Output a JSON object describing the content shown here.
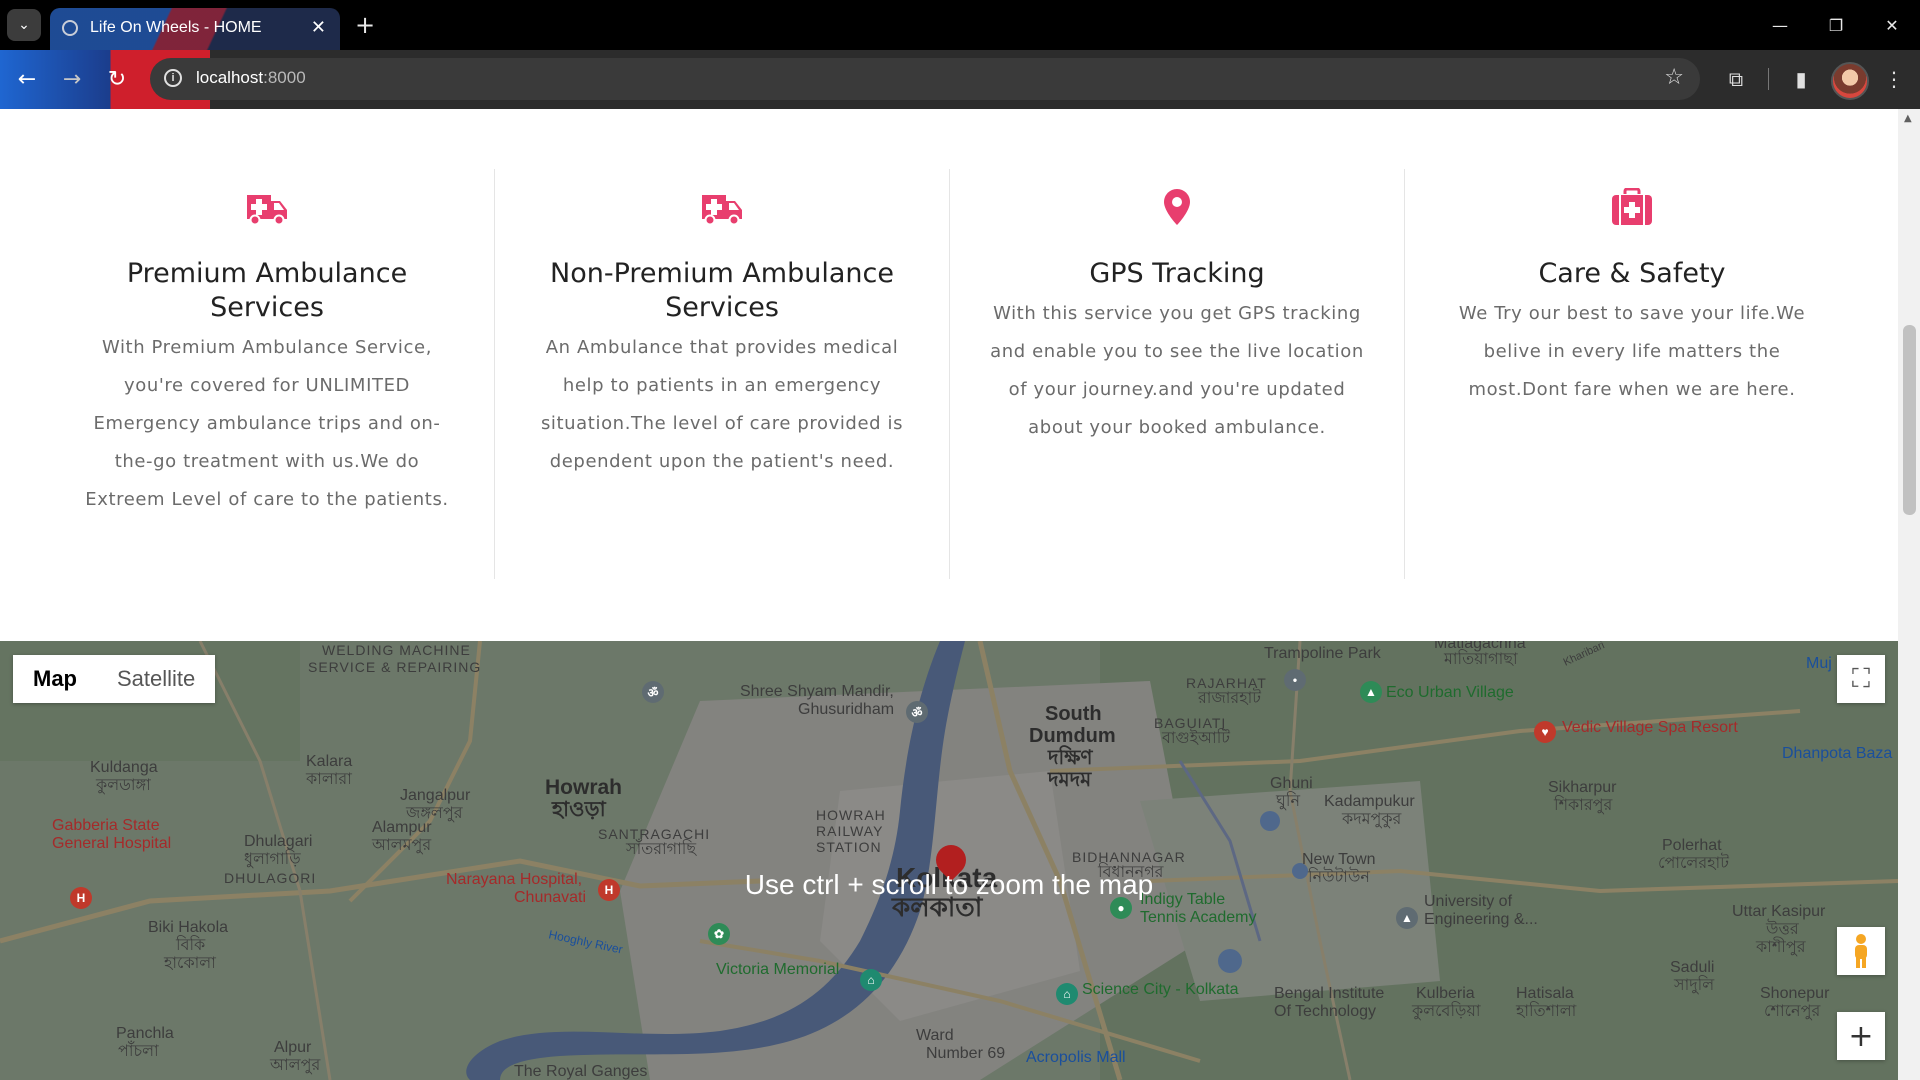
{
  "browser": {
    "tab_title": "Life On Wheels - HOME",
    "tab_close": "✕",
    "new_tab": "+",
    "url_host": "localhost",
    "url_port": ":8000",
    "info_glyph": "i",
    "icons": [
      "tab-search-icon",
      "back-arrow-icon",
      "forward-arrow-icon",
      "reload-icon",
      "site-info-icon",
      "bookmark-star-icon",
      "extensions-icon",
      "side-panel-icon",
      "profile-avatar",
      "kebab-menu-icon",
      "minimize-icon",
      "restore-icon",
      "close-window-icon"
    ]
  },
  "theme": {
    "accent": "#e83e6e",
    "title_color": "#222222",
    "body_text": "#6b6b6b"
  },
  "features": [
    {
      "icon": "ambulance-icon",
      "title": "Premium Ambulance Services",
      "text": "With Premium Ambulance Service, you're covered for UNLIMITED Emergency ambulance trips and on-the-go treatment with us.We do Extreem Level of care to the patients."
    },
    {
      "icon": "ambulance-icon",
      "title": "Non-Premium Ambulance Services",
      "text": "An Ambulance that provides medical help to patients in an emergency situation.The level of care provided is dependent upon the patient's need."
    },
    {
      "icon": "map-pin-icon",
      "title": "GPS Tracking",
      "text": "With this service you get GPS tracking and enable you to see the live location of your journey.and you're updated about your booked ambulance."
    },
    {
      "icon": "medical-kit-icon",
      "title": "Care & Safety",
      "text": "We Try our best to save your life.We belive in every life matters the most.Dont fare when we are here."
    }
  ],
  "map": {
    "type_map": "Map",
    "type_satellite": "Satellite",
    "hint": "Use ctrl + scroll to zoom the map",
    "zoom_in": "+",
    "labels": {
      "welding": "WELDING MACHINE",
      "welding2": "SERVICE & REPAIRING",
      "kuldanga": "Kuldanga",
      "kuldanga_bn": "কুলডাঙ্গা",
      "kalara": "Kalara",
      "kalara_bn": "কালারা",
      "jangalpur": "Jangalpur",
      "jangalpur_bn": "জঙ্গলপুর",
      "howrah": "Howrah",
      "howrah_bn": "হাওড়া",
      "santragachi": "SANTRAGACHI",
      "santragachi_bn": "সাঁতরাগাছি",
      "gabberia": "Gabberia State",
      "gabberia2": "General Hospital",
      "dhulagari": "Dhulagari",
      "dhulagari_bn": "ধুলাগাড়ি",
      "dhulagori": "DHULAGORI",
      "alampur": "Alampur",
      "alampur_bn": "আলমপুর",
      "narayana": "Narayana Hospital,",
      "narayana2": "Chunavati",
      "biki": "Biki Hakola",
      "biki_bn": "বিকি",
      "biki_bn2": "হাকোলা",
      "panchla": "Panchla",
      "panchla_bn": "পাঁচলা",
      "alpur": "Alpur",
      "alpur_bn": "আলপুর",
      "hooghly": "Hooghly River",
      "shree": "Shree Shyam Mandir,",
      "shree2": "Ghusuridham",
      "howrah_station": "HOWRAH",
      "howrah_station2": "RAILWAY",
      "howrah_station3": "STATION",
      "kolkata": "Kolkata",
      "kolkata_bn": "কলকাতা",
      "victoria": "Victoria Memorial",
      "ward": "Ward",
      "ward2": "Number 69",
      "royal": "The Royal Ganges",
      "south_dumdum": "South",
      "south_dumdum2": "Dumdum",
      "south_dumdum_bn": "দক্ষিণ",
      "south_dumdum_bn2": "দমদম",
      "rajarhat": "RAJARHAT",
      "rajarhat_bn": "রাজারহাট",
      "baguiati": "BAGUIATI",
      "baguiati_bn": "বাগুইআটি",
      "bidhannagar": "BIDHANNAGAR",
      "bidhannagar_bn": "বিধাননগর",
      "trampoline": "Trampoline Park",
      "matiagachha": "Matiagachha",
      "matiagachha_bn": "মাতিয়াগাছা",
      "eco_urban": "Eco Urban Village",
      "ghuni": "Ghuni",
      "ghuni_bn": "ঘুনি",
      "kadampukur": "Kadampukur",
      "kadampukur_bn": "কদমপুকুর",
      "newtown": "New Town",
      "newtown_bn": "নিউটাউন",
      "tennis": "Tennis Academy",
      "tabletennis": "Indigy Table",
      "science": "Science City - Kolkata",
      "acropolis": "Acropolis Mall",
      "bengal": "Bengal Institute",
      "bengal2": "Of Technology",
      "university": "University of",
      "university2": "Engineering &...",
      "kulberia": "Kulberia",
      "kulberia_bn": "কুলবেড়িয়া",
      "hatisala": "Hatisala",
      "hatisala_bn": "হাতিশালা",
      "vedic": "Vedic Village Spa Resort",
      "sikharpur": "Sikharpur",
      "sikharpur_bn": "শিকারপুর",
      "polerhat": "Polerhat",
      "polerhat_bn": "পোলেরহাট",
      "uttar": "Uttar Kasipur",
      "uttar_bn": "উত্তর",
      "uttar_bn2": "কাশীপুর",
      "saduli": "Saduli",
      "saduli_bn": "সাদুলি",
      "shonepur": "Shonepur",
      "shonepur_bn": "শোনেপুর",
      "dhanpota": "Dhanpota Baza",
      "muj": "Muj",
      "kharibari": "Kharibari"
    }
  }
}
